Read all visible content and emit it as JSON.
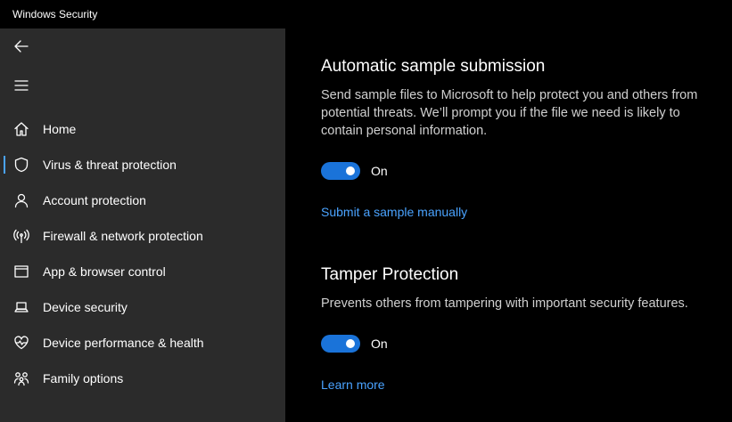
{
  "window": {
    "title": "Windows Security"
  },
  "sidebar": {
    "back_icon": "back-arrow-icon",
    "menu_icon": "hamburger-menu-icon",
    "items": [
      {
        "label": "Home",
        "icon": "home-icon",
        "selected": false
      },
      {
        "label": "Virus & threat protection",
        "icon": "shield-icon",
        "selected": true
      },
      {
        "label": "Account protection",
        "icon": "person-icon",
        "selected": false
      },
      {
        "label": "Firewall & network protection",
        "icon": "antenna-icon",
        "selected": false
      },
      {
        "label": "App & browser control",
        "icon": "app-window-icon",
        "selected": false
      },
      {
        "label": "Device security",
        "icon": "laptop-icon",
        "selected": false
      },
      {
        "label": "Device performance & health",
        "icon": "heart-pulse-icon",
        "selected": false
      },
      {
        "label": "Family options",
        "icon": "family-icon",
        "selected": false
      }
    ]
  },
  "main": {
    "sample_submission": {
      "title": "Automatic sample submission",
      "description": "Send sample files to Microsoft to help protect you and others from potential threats. We’ll prompt you if the file we need is likely to contain personal information.",
      "toggle_state": "On",
      "link": "Submit a sample manually"
    },
    "tamper_protection": {
      "title": "Tamper Protection",
      "description": "Prevents others from tampering with important security features.",
      "toggle_state": "On",
      "link": "Learn more"
    }
  },
  "colors": {
    "accent": "#1a73d9",
    "link": "#4aa3ff",
    "sidebar_bg": "#2b2b2b",
    "main_bg": "#000000"
  }
}
